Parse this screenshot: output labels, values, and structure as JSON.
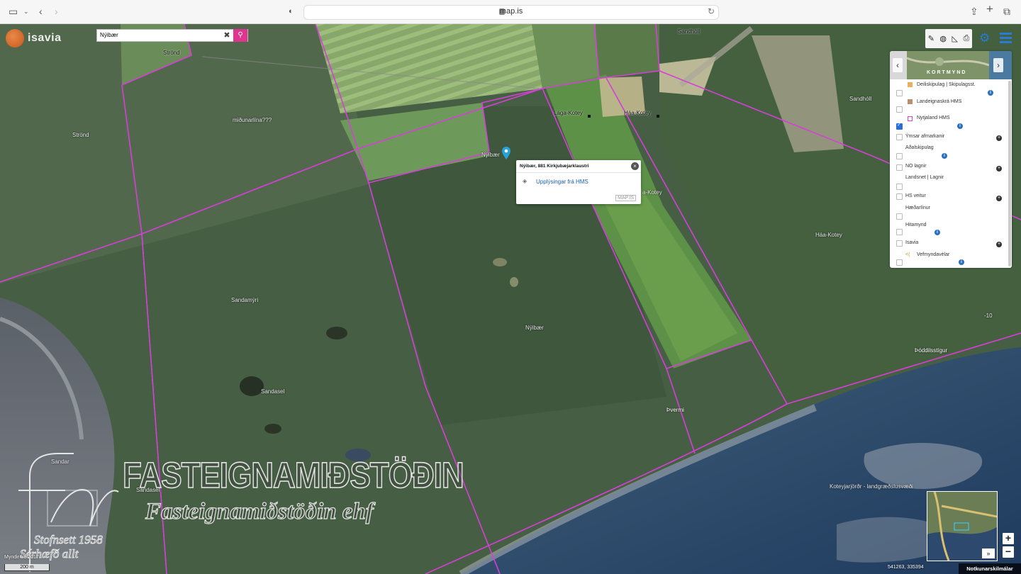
{
  "browser": {
    "url": "map.is",
    "icons": [
      "sidebar-icon",
      "back-icon",
      "forward-icon",
      "shield-icon",
      "reload-icon",
      "share-icon",
      "new-tab-icon",
      "tabs-icon"
    ]
  },
  "logo": {
    "text": "isavia"
  },
  "search": {
    "value": "Nýibær"
  },
  "popup": {
    "title": "Nýibær, 881 Kirkjubæjarklaustri",
    "link": "Upplýsingar frá HMS",
    "brand": "MAP.IS"
  },
  "panel": {
    "basemap_label": "KORTMYND",
    "layers": [
      {
        "label": "Deiliskipulag | Skipulagsst.",
        "checked": false,
        "swatch": "#e8b060"
      },
      {
        "label": "Landeignaskrá HMS",
        "checked": false,
        "swatch": "#b89070"
      },
      {
        "label": "Nytjaland HMS",
        "checked": true,
        "swatch": "#e040c0"
      },
      {
        "label": "Ýmsar afmarkanir",
        "checked": false
      },
      {
        "label": "Aðalskipulag",
        "checked": false
      },
      {
        "label": "NO lagnir",
        "checked": false
      },
      {
        "label": "Landsnet | Lagnir",
        "checked": false
      },
      {
        "label": "HS veitur",
        "checked": false
      },
      {
        "label": "Hæðarlínur",
        "checked": false
      },
      {
        "label": "Hitamynd",
        "checked": false
      },
      {
        "label": "Isavia",
        "checked": false
      },
      {
        "label": "Vefmyndavélar",
        "checked": false
      }
    ]
  },
  "places": {
    "sandholl_top": "Sandhóll",
    "strond_top": "Strönd",
    "midunarlina": "miðunarlína???",
    "strond": "Strönd",
    "laga_kotey": "Lága-Kotey",
    "haa_kotey_top": "Háa-Kotey",
    "sandholl": "Sandhóll",
    "nyibaer_marker": "Nýibær",
    "a_kotey": "a-Kotey",
    "haa_kotey": "Háa-Kotey",
    "sandamyri": "Sandamýri",
    "nyibaer": "Nýibær",
    "minus10": "-10",
    "poddilsstgur": "Þóddilsstígur",
    "sandasel": "Sandasel",
    "pvermi": "Þvermi",
    "sandar": "Sandar",
    "sandasel2": "Sandasel",
    "koteyjarjordr": "Koteyjarjörðr - landgræðslusvæði"
  },
  "watermark": {
    "line1": "FASTEIGNAMIÐSTÖÐIN",
    "line2": "Fasteignamiðstöðin ehf",
    "line3": "Stofnsett 1958",
    "line4": "Sérhæfð allt"
  },
  "map_footer": {
    "credit": "Myndir frá 2017",
    "scale": "200 m",
    "coords": "541263, 335394",
    "terms": "Notkunarskilmálar"
  },
  "overview": {
    "collapse_label": "»"
  },
  "colors": {
    "boundary": "#d63fd8",
    "accent": "#2a7bd8",
    "search_pin": "#e0358e"
  }
}
